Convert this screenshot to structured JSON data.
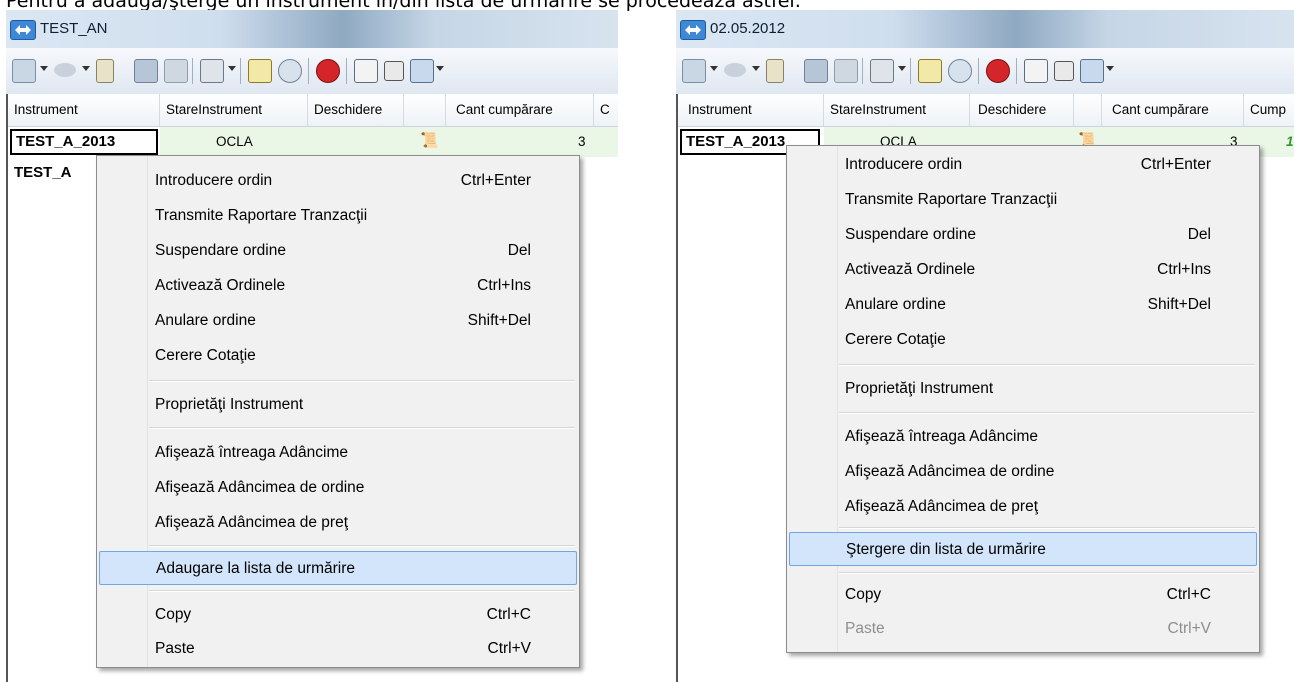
{
  "caption": "Pentru a adăuga/şterge un instrument în/din lista de urmărire se procedează astfel:",
  "left_window": {
    "title": "TEST_AN",
    "columns": [
      "Instrument",
      "StareInstrument",
      "Deschidere",
      "",
      "Cant cumpărare",
      "C"
    ],
    "rows": [
      {
        "instrument": "TEST_A_2013",
        "stare": "OCLA",
        "cant": "3"
      },
      {
        "instrument": "TEST_A",
        "stare": "",
        "cant": ""
      }
    ],
    "menu": [
      {
        "label": "Introducere ordin",
        "shortcut": "Ctrl+Enter"
      },
      {
        "label": "Transmite Raportare Tranzacţii",
        "shortcut": ""
      },
      {
        "label": "Suspendare ordine",
        "shortcut": "Del"
      },
      {
        "label": "Activează Ordinele",
        "shortcut": "Ctrl+Ins"
      },
      {
        "label": "Anulare ordine",
        "shortcut": "Shift+Del"
      },
      {
        "label": "Cerere Cotaţie",
        "shortcut": ""
      },
      {
        "label": "Proprietăţi Instrument",
        "shortcut": ""
      },
      {
        "label": "Afişează întreaga Adâncime",
        "shortcut": ""
      },
      {
        "label": "Afişează Adâncimea de ordine",
        "shortcut": ""
      },
      {
        "label": "Afişează Adâncimea de preţ",
        "shortcut": ""
      },
      {
        "label": "Adaugare la lista de urmărire",
        "shortcut": "",
        "highlighted": true
      },
      {
        "label": "Copy",
        "shortcut": "Ctrl+C"
      },
      {
        "label": "Paste",
        "shortcut": "Ctrl+V"
      }
    ]
  },
  "right_window": {
    "title": "02.05.2012",
    "columns": [
      "Instrument",
      "StareInstrument",
      "Deschidere",
      "",
      "Cant cumpărare",
      "Cump"
    ],
    "rows": [
      {
        "instrument": "TEST_A_2013",
        "stare": "OCLA",
        "cant": "3",
        "extra": "1"
      }
    ],
    "menu": [
      {
        "label": "Introducere ordin",
        "shortcut": "Ctrl+Enter"
      },
      {
        "label": "Transmite Raportare Tranzacţii",
        "shortcut": ""
      },
      {
        "label": "Suspendare ordine",
        "shortcut": "Del"
      },
      {
        "label": "Activează Ordinele",
        "shortcut": "Ctrl+Ins"
      },
      {
        "label": "Anulare ordine",
        "shortcut": "Shift+Del"
      },
      {
        "label": "Cerere Cotaţie",
        "shortcut": ""
      },
      {
        "label": "Proprietăţi Instrument",
        "shortcut": ""
      },
      {
        "label": "Afişează întreaga Adâncime",
        "shortcut": ""
      },
      {
        "label": "Afişează Adâncimea de ordine",
        "shortcut": ""
      },
      {
        "label": "Afişează Adâncimea de preţ",
        "shortcut": ""
      },
      {
        "label": "Ştergere din lista de urmărire",
        "shortcut": "",
        "highlighted": true
      },
      {
        "label": "Copy",
        "shortcut": "Ctrl+C"
      },
      {
        "label": "Paste",
        "shortcut": "Ctrl+V",
        "disabled": true
      }
    ]
  }
}
